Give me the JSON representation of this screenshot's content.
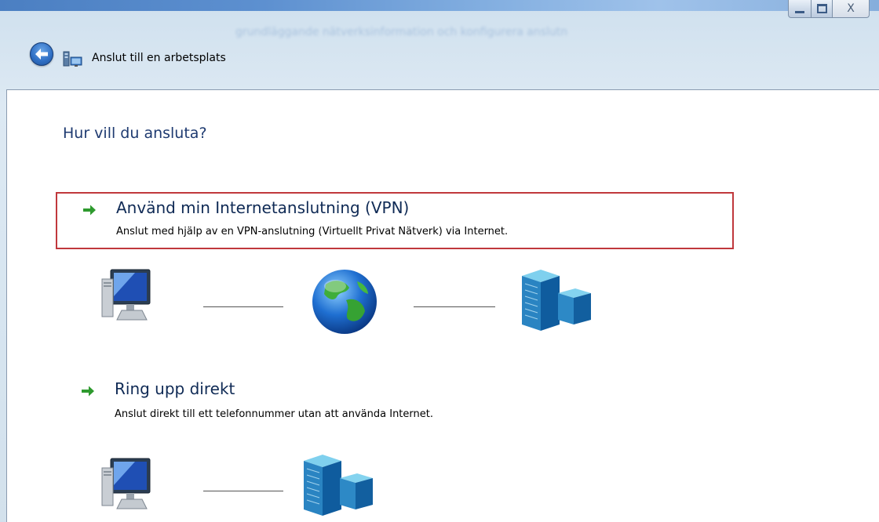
{
  "window": {
    "minimize_glyph": "minimize-icon",
    "maximize_glyph": "maximize-icon",
    "close_glyph": "X"
  },
  "header": {
    "title": "Anslut till en arbetsplats",
    "background_text": "grundläggande nätverksinformation och konfigurera anslutn"
  },
  "content": {
    "question": "Hur vill du ansluta?",
    "options": [
      {
        "title": "Använd min Internetanslutning (VPN)",
        "description": "Anslut med hjälp av en VPN-anslutning (Virtuellt Privat Nätverk) via Internet.",
        "selected": true,
        "diagram": [
          "computer-icon",
          "globe-icon",
          "server-icon"
        ]
      },
      {
        "title": "Ring upp direkt",
        "description": "Anslut direkt till ett telefonnummer utan att använda Internet.",
        "selected": false,
        "diagram": [
          "computer-icon",
          "server-icon"
        ]
      }
    ]
  },
  "colors": {
    "selection_border": "#c0383c",
    "arrow_green": "#2e9a2e",
    "heading_blue": "#1e3a70"
  }
}
